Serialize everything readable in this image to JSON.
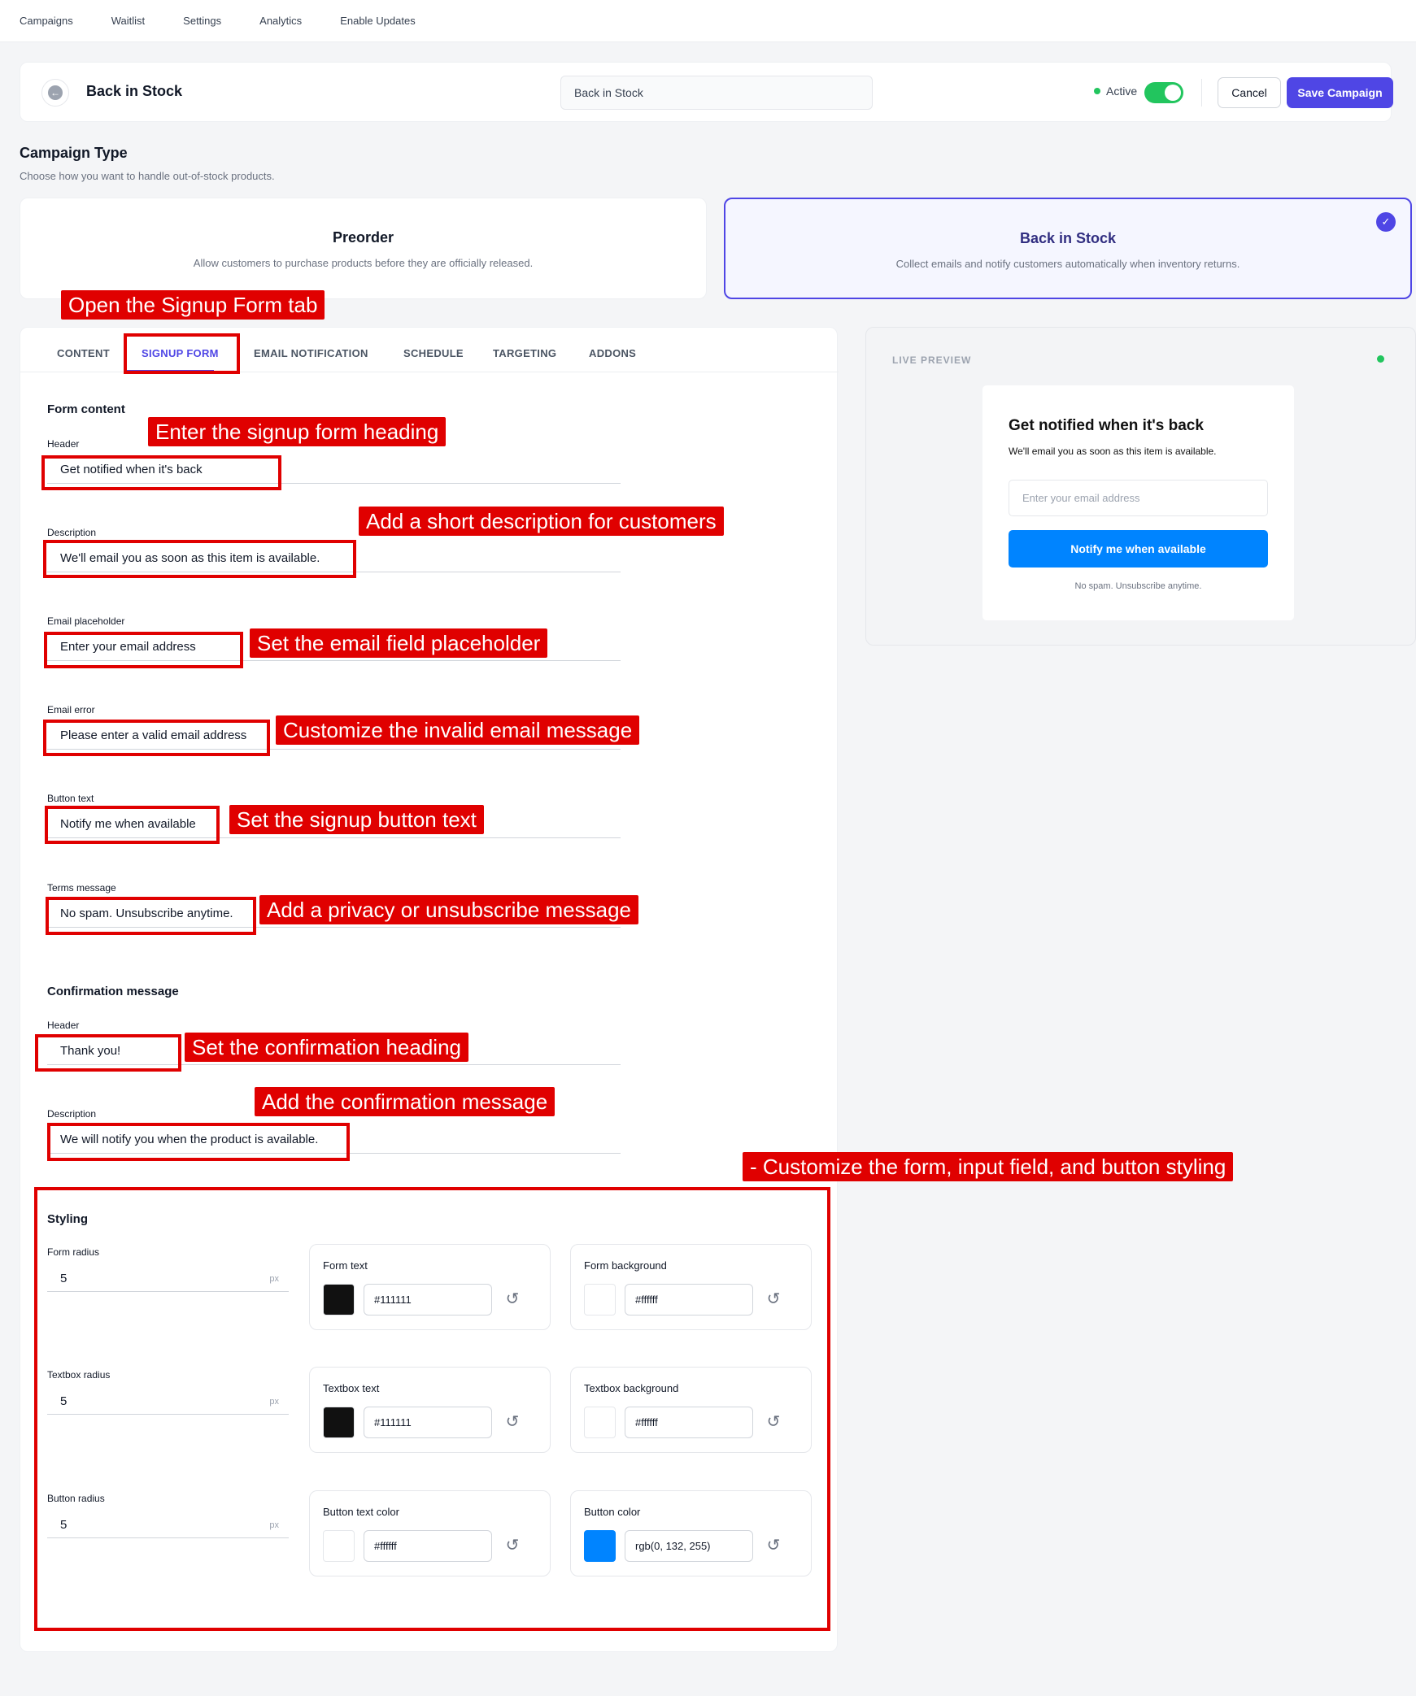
{
  "topnav": {
    "items": [
      "Campaigns",
      "Waitlist",
      "Settings",
      "Analytics",
      "Enable Updates"
    ]
  },
  "header": {
    "title": "Back in Stock",
    "name_value": "Back in Stock",
    "status": "Active",
    "toggle_on": true,
    "cancel": "Cancel",
    "save": "Save Campaign"
  },
  "campaign_type": {
    "title": "Campaign Type",
    "subtitle": "Choose how you want to handle out-of-stock products.",
    "options": [
      {
        "title": "Preorder",
        "desc": "Allow customers to purchase products before they are officially released.",
        "selected": false
      },
      {
        "title": "Back in Stock",
        "desc": "Collect emails and notify customers automatically when inventory returns.",
        "selected": true
      }
    ]
  },
  "tabs": [
    "CONTENT",
    "SIGNUP FORM",
    "EMAIL NOTIFICATION",
    "SCHEDULE",
    "TARGETING",
    "ADDONS"
  ],
  "active_tab": "SIGNUP FORM",
  "form_content": {
    "title": "Form content",
    "fields": [
      {
        "label": "Header",
        "value": "Get notified when it's back"
      },
      {
        "label": "Description",
        "value": "We'll email you as soon as this item is available."
      },
      {
        "label": "Email placeholder",
        "value": "Enter your email address"
      },
      {
        "label": "Email error",
        "value": "Please enter a valid email address"
      },
      {
        "label": "Button text",
        "value": "Notify me when available"
      },
      {
        "label": "Terms message",
        "value": "No spam. Unsubscribe anytime."
      }
    ]
  },
  "confirmation": {
    "title": "Confirmation message",
    "fields": [
      {
        "label": "Header",
        "value": "Thank you!"
      },
      {
        "label": "Description",
        "value": "We will notify you when the product is available."
      }
    ]
  },
  "styling": {
    "title": "Styling",
    "unit": "px",
    "radius": [
      {
        "label": "Form radius",
        "value": "5"
      },
      {
        "label": "Textbox radius",
        "value": "5"
      },
      {
        "label": "Button radius",
        "value": "5"
      }
    ],
    "colors": [
      {
        "label": "Form text",
        "value": "#111111",
        "swatch": "#111111"
      },
      {
        "label": "Form background",
        "value": "#ffffff",
        "swatch": "#ffffff"
      },
      {
        "label": "Textbox text",
        "value": "#111111",
        "swatch": "#111111"
      },
      {
        "label": "Textbox background",
        "value": "#ffffff",
        "swatch": "#ffffff"
      },
      {
        "label": "Button text color",
        "value": "#ffffff",
        "swatch": "#ffffff"
      },
      {
        "label": "Button color",
        "value": "rgb(0, 132, 255)",
        "swatch": "#0084ff"
      }
    ]
  },
  "preview": {
    "label": "LIVE PREVIEW",
    "title": "Get notified when it's back",
    "desc": "We'll email you as soon as this item is available.",
    "placeholder": "Enter your email address",
    "button": "Notify me when available",
    "terms": "No spam. Unsubscribe anytime."
  },
  "annotations": [
    "Open the Signup Form tab",
    "Enter the signup form heading",
    "Add a short description for customers",
    "Set the email field placeholder",
    "Customize the invalid email message",
    "Set the signup button text",
    "Add a privacy or unsubscribe message",
    "Set the confirmation heading",
    "Add the confirmation message",
    "- Customize the form, input field, and button styling"
  ],
  "colors": {
    "accent": "#4f46e5",
    "active": "#22c55e",
    "annotation": "#e00000",
    "preview_button": "rgb(0,132,255)"
  }
}
